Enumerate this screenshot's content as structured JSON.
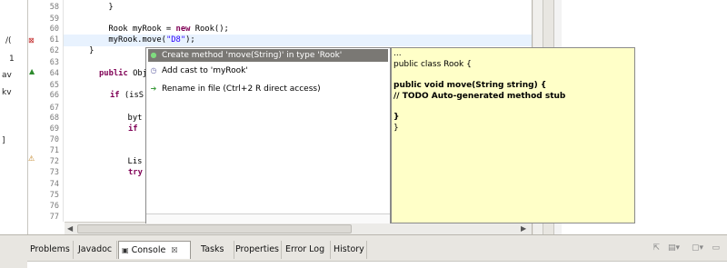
{
  "left_strip": {
    "items": [
      "/(",
      "1",
      "av",
      "kv",
      "]"
    ]
  },
  "editor": {
    "lines": [
      {
        "num": "58",
        "code": "        }"
      },
      {
        "num": "59",
        "code": ""
      },
      {
        "num": "60",
        "code_a": "        Rook myRook = ",
        "kw": "new",
        "code_b": " Rook();"
      },
      {
        "num": "61",
        "code_a": "        myRook.move(",
        "str": "\"D8\"",
        "code_b": ");"
      },
      {
        "num": "62",
        "code": "    }"
      },
      {
        "num": "63",
        "code": ""
      },
      {
        "num": "64",
        "kw": "public",
        "code_b": " Obje"
      },
      {
        "num": "65",
        "code": ""
      },
      {
        "num": "66",
        "kw": "if",
        "code_b": " (isS"
      },
      {
        "num": "67",
        "code": ""
      },
      {
        "num": "68",
        "code": "            byt"
      },
      {
        "num": "69",
        "kw": "if",
        "code_b": ""
      },
      {
        "num": "70",
        "code": ""
      },
      {
        "num": "71",
        "code": ""
      },
      {
        "num": "72",
        "code": "            Lis"
      },
      {
        "num": "73",
        "kw": "try",
        "code_b": ""
      },
      {
        "num": "74",
        "code": ""
      },
      {
        "num": "75",
        "code": ""
      },
      {
        "num": "76",
        "code": ""
      },
      {
        "num": "77",
        "code": ""
      }
    ]
  },
  "quick_fix": {
    "items": [
      {
        "label": "Create method 'move(String)' in type 'Rook'",
        "icon": "create-method-icon",
        "selected": true
      },
      {
        "label": "Add cast to 'myRook'",
        "icon": "cast-icon",
        "selected": false
      },
      {
        "label": "Rename in file (Ctrl+2 R direct access)",
        "icon": "rename-icon",
        "selected": false
      }
    ],
    "preview": {
      "ellipsis": "...",
      "line1": "public class Rook {",
      "line2": "public void move(String string) {",
      "line3": "// TODO Auto-generated method stub",
      "line4": "}",
      "line5": "}"
    }
  },
  "views": {
    "tabs": [
      {
        "label": "Problems"
      },
      {
        "label": "Javadoc"
      },
      {
        "label": "Console",
        "active": true,
        "close": "☒"
      },
      {
        "label": "Tasks"
      },
      {
        "label": "Properties"
      },
      {
        "label": "Error Log"
      },
      {
        "label": "History"
      }
    ]
  },
  "colors": {
    "keyword": "#7f0055",
    "string": "#2a00ff",
    "selection": "#7a7874",
    "preview_bg": "#ffffc8"
  }
}
